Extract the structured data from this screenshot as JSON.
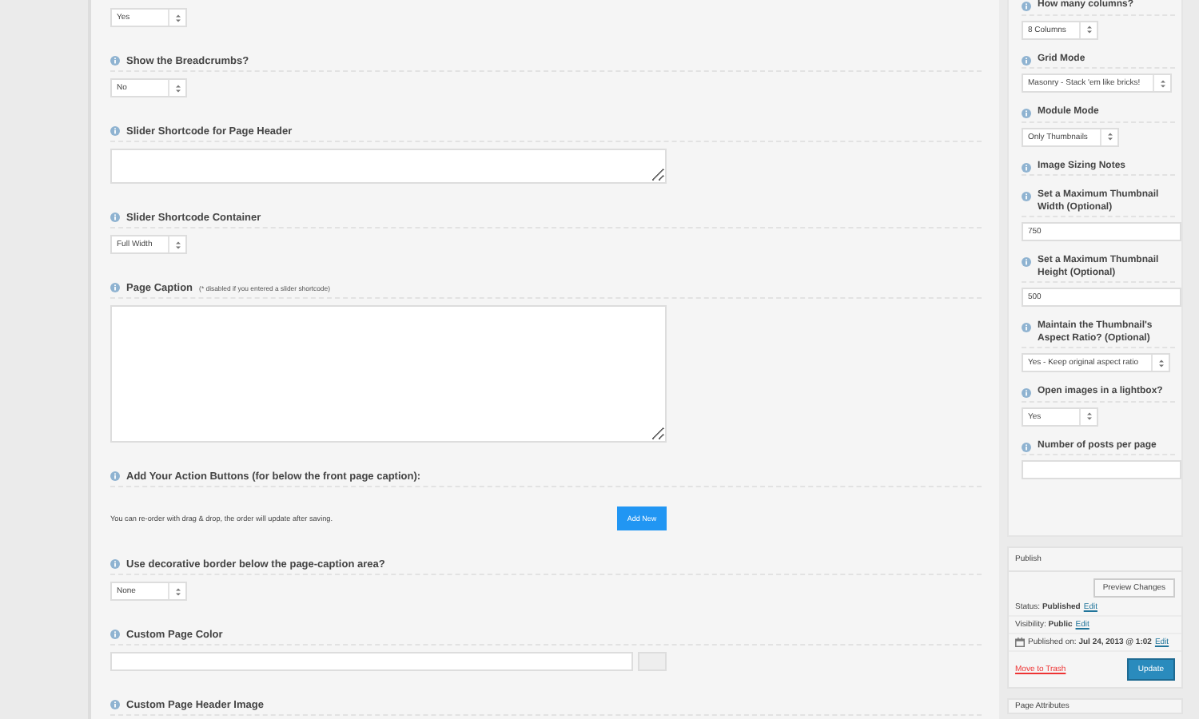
{
  "main_fields": [
    {
      "kind": "select",
      "value": "Yes"
    },
    {
      "kind": "select",
      "label": "Show the Breadcrumbs?",
      "value": "No"
    },
    {
      "kind": "textline",
      "label": "Slider Shortcode for Page Header"
    },
    {
      "kind": "select",
      "label": "Slider Shortcode Container",
      "value": "Full Width"
    },
    {
      "kind": "textarea",
      "label": "Page Caption",
      "note": "(* disabled if you entered a slider shortcode)"
    },
    {
      "kind": "buttons",
      "label": "Add Your Action Buttons (for below the front page caption):",
      "text": "You can re-order with drag & drop, the order will update after saving.",
      "button": "Add New"
    },
    {
      "kind": "select",
      "label": "Use decorative border below the page-caption area?",
      "value": "None"
    },
    {
      "kind": "color",
      "label": "Custom Page Color"
    },
    {
      "kind": "cut",
      "label": "Custom Page Header Image"
    }
  ],
  "side_fields": [
    {
      "kind": "select",
      "label": "How many columns?",
      "value": "8 Columns"
    },
    {
      "kind": "select",
      "label": "Grid Mode",
      "value": "Masonry - Stack 'em like bricks!"
    },
    {
      "kind": "select",
      "label": "Module Mode",
      "value": "Only Thumbnails"
    },
    {
      "kind": "note",
      "label": "Image Sizing Notes"
    },
    {
      "kind": "text",
      "label": "Set a Maximum Thumbnail Width (Optional)",
      "value": "750"
    },
    {
      "kind": "text",
      "label": "Set a Maximum Thumbnail Height (Optional)",
      "value": "500"
    },
    {
      "kind": "select",
      "label": "Maintain the Thumbnail's Aspect Ratio? (Optional)",
      "value": "Yes - Keep original aspect ratio"
    },
    {
      "kind": "select",
      "label": "Open images in a lightbox?",
      "value": "Yes"
    },
    {
      "kind": "text",
      "label": "Number of posts per page"
    }
  ],
  "publish": {
    "title": "Publish",
    "preview_button": "Preview Changes",
    "rows": [
      {
        "text": "Status: **Published**",
        "link": "Edit",
        "icon": false
      },
      {
        "text": "Visibility: **Public**",
        "link": "Edit",
        "icon": false
      },
      {
        "text": "Published on: **Jul 24, 2013 @ 1:02**",
        "link": "Edit",
        "icon": true
      }
    ],
    "trash_link": "Move to Trash",
    "update_button": "Update"
  },
  "next_box": {
    "title": "Page Attributes"
  }
}
